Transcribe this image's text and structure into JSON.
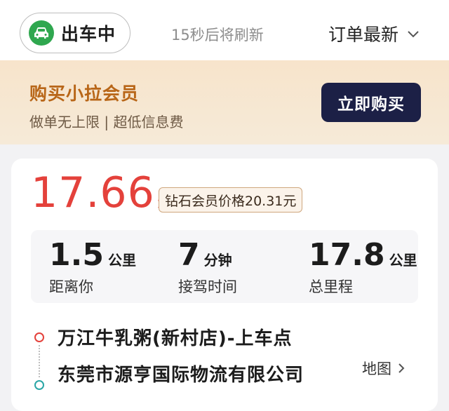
{
  "header": {
    "status_label": "出车中",
    "status_icon": "car-icon",
    "refresh_text": "15秒后将刷新",
    "order_sort_label": "订单最新"
  },
  "promo": {
    "title": "购买小拉会员",
    "subtitle": "做单无上限 | 超低信息费",
    "buy_button": "立即购买"
  },
  "order": {
    "price": "17.66",
    "price_unit": "元",
    "member_price": "钻石会员价格20.31元",
    "stats": [
      {
        "value": "1.5",
        "unit": "公里",
        "caption": "距离你"
      },
      {
        "value": "7",
        "unit": "分钟",
        "caption": "接驾时间"
      },
      {
        "value": "17.8",
        "unit": "公里",
        "caption": "总里程"
      }
    ],
    "pickup": "万江牛乳粥(新村店)-上车点",
    "dropoff": "东莞市源亨国际物流有限公司",
    "map_label": "地图"
  },
  "colors": {
    "accent_red": "#e4413b",
    "status_green": "#2fa74f",
    "promo_orange": "#b86618",
    "button_navy": "#1c2046"
  }
}
